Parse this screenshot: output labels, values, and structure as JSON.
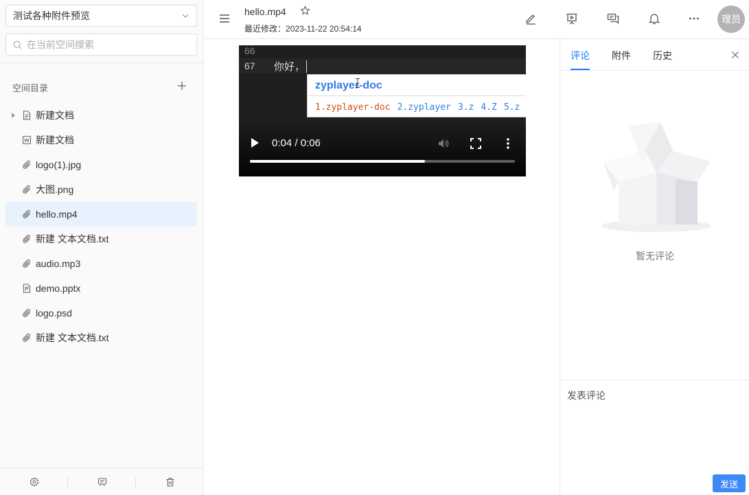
{
  "sidebar": {
    "space_name": "测试各种附件预览",
    "search_placeholder": "在当前空间搜索",
    "dir_title": "空间目录",
    "items": [
      {
        "label": "新建文档",
        "icon": "doc-icon",
        "expandable": true
      },
      {
        "label": "新建文档",
        "icon": "word-doc-icon"
      },
      {
        "label": "logo(1).jpg",
        "icon": "attachment-icon"
      },
      {
        "label": "大图.png",
        "icon": "attachment-icon"
      },
      {
        "label": "hello.mp4",
        "icon": "attachment-icon",
        "active": true
      },
      {
        "label": "新建 文本文档.txt",
        "icon": "attachment-icon"
      },
      {
        "label": "audio.mp3",
        "icon": "attachment-icon"
      },
      {
        "label": "demo.pptx",
        "icon": "ppt-doc-icon"
      },
      {
        "label": "logo.psd",
        "icon": "attachment-icon"
      },
      {
        "label": "新建 文本文档.txt",
        "icon": "attachment-icon"
      }
    ],
    "bottom_icons": [
      "settings-icon",
      "comment-board-icon",
      "trash-icon"
    ]
  },
  "header": {
    "title": "hello.mp4",
    "modified_label": "最近修改：",
    "modified_time": "2023-11-22 20:54:14",
    "avatar_text": "理员",
    "actions": [
      "edit-icon",
      "presentation-icon",
      "comments-icon",
      "bell-icon",
      "more-icon"
    ]
  },
  "video": {
    "line_66": "66",
    "line_67": "67",
    "typed_text": "你好，",
    "ime_input": "zyplayer-doc",
    "ime_candidates": [
      "1.zyplayer-doc",
      "2.zyplayer",
      "3.z",
      "4.Z",
      "5.z"
    ],
    "time_display": "0:04 / 0:06",
    "progress": 0.66
  },
  "right_panel": {
    "tabs": [
      "评论",
      "附件",
      "历史"
    ],
    "active_tab": 0,
    "empty_text": "暂无评论",
    "comment_placeholder": "发表评论",
    "send_label": "发送"
  },
  "colors": {
    "accent": "#1677ff",
    "active_item_bg": "#e8f2fe",
    "send_button": "#3d8af7"
  }
}
